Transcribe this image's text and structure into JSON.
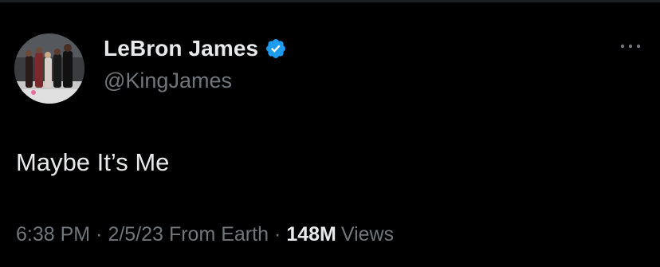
{
  "author": {
    "display_name": "LeBron James",
    "handle": "@KingJames",
    "verified": true,
    "verified_badge_color": "#1d9bf0"
  },
  "tweet": {
    "text": "Maybe It’s Me"
  },
  "meta": {
    "time": "6:38 PM",
    "separator": "·",
    "date": "2/5/23",
    "source": "From Earth",
    "views_count": "148M",
    "views_label": "Views"
  },
  "icons": {
    "more": "more-horizontal-icon",
    "verified": "verified-badge-icon"
  },
  "colors": {
    "background": "#000000",
    "primary_text": "#e7e9ea",
    "secondary_text": "#71767b"
  }
}
